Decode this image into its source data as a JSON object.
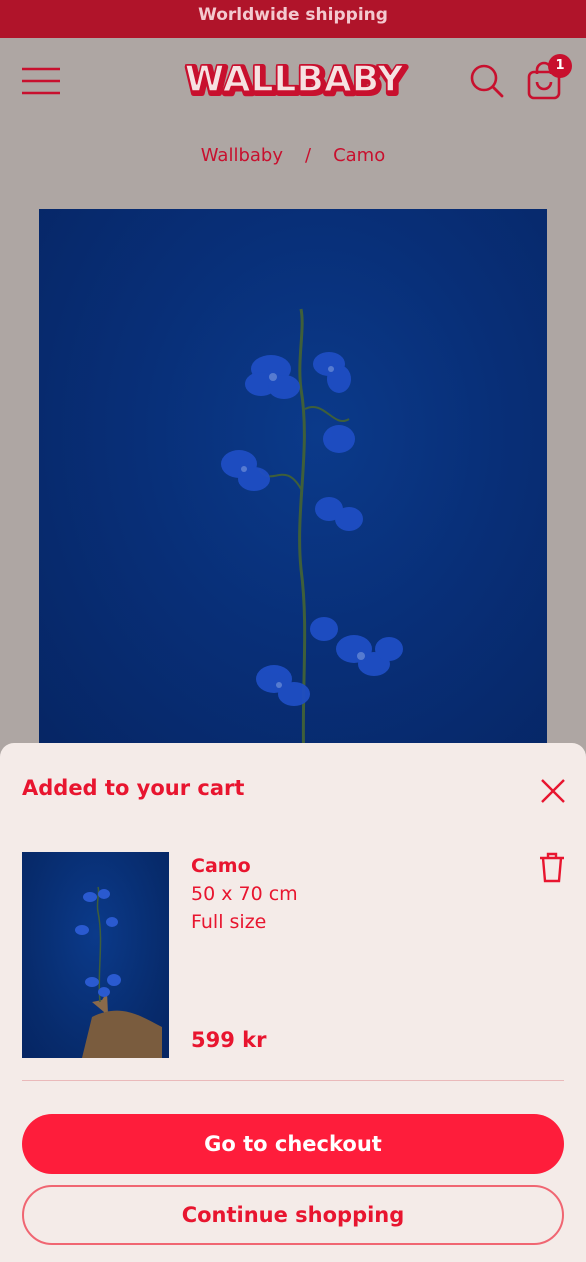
{
  "announcement": {
    "text": "Worldwide shipping"
  },
  "header": {
    "logo_text": "WALLBABY",
    "cart_count": "1",
    "icons": [
      "menu-icon",
      "search-icon",
      "shopping-bag-icon"
    ]
  },
  "breadcrumb": {
    "home": "Wallbaby",
    "separator": "/",
    "current": "Camo"
  },
  "cart_drawer": {
    "title": "Added to your cart",
    "item": {
      "name": "Camo",
      "size": "50 x 70 cm",
      "variant": "Full size",
      "price": "599 kr"
    },
    "checkout_label": "Go to checkout",
    "continue_label": "Continue shopping"
  },
  "colors": {
    "accent": "#fe1d3b",
    "brand_red": "#c8102e",
    "announcement_bg": "#b0142a",
    "header_bg": "#aea6a3",
    "drawer_bg": "#f4ebe8",
    "artwork_blue": "#082f78"
  }
}
